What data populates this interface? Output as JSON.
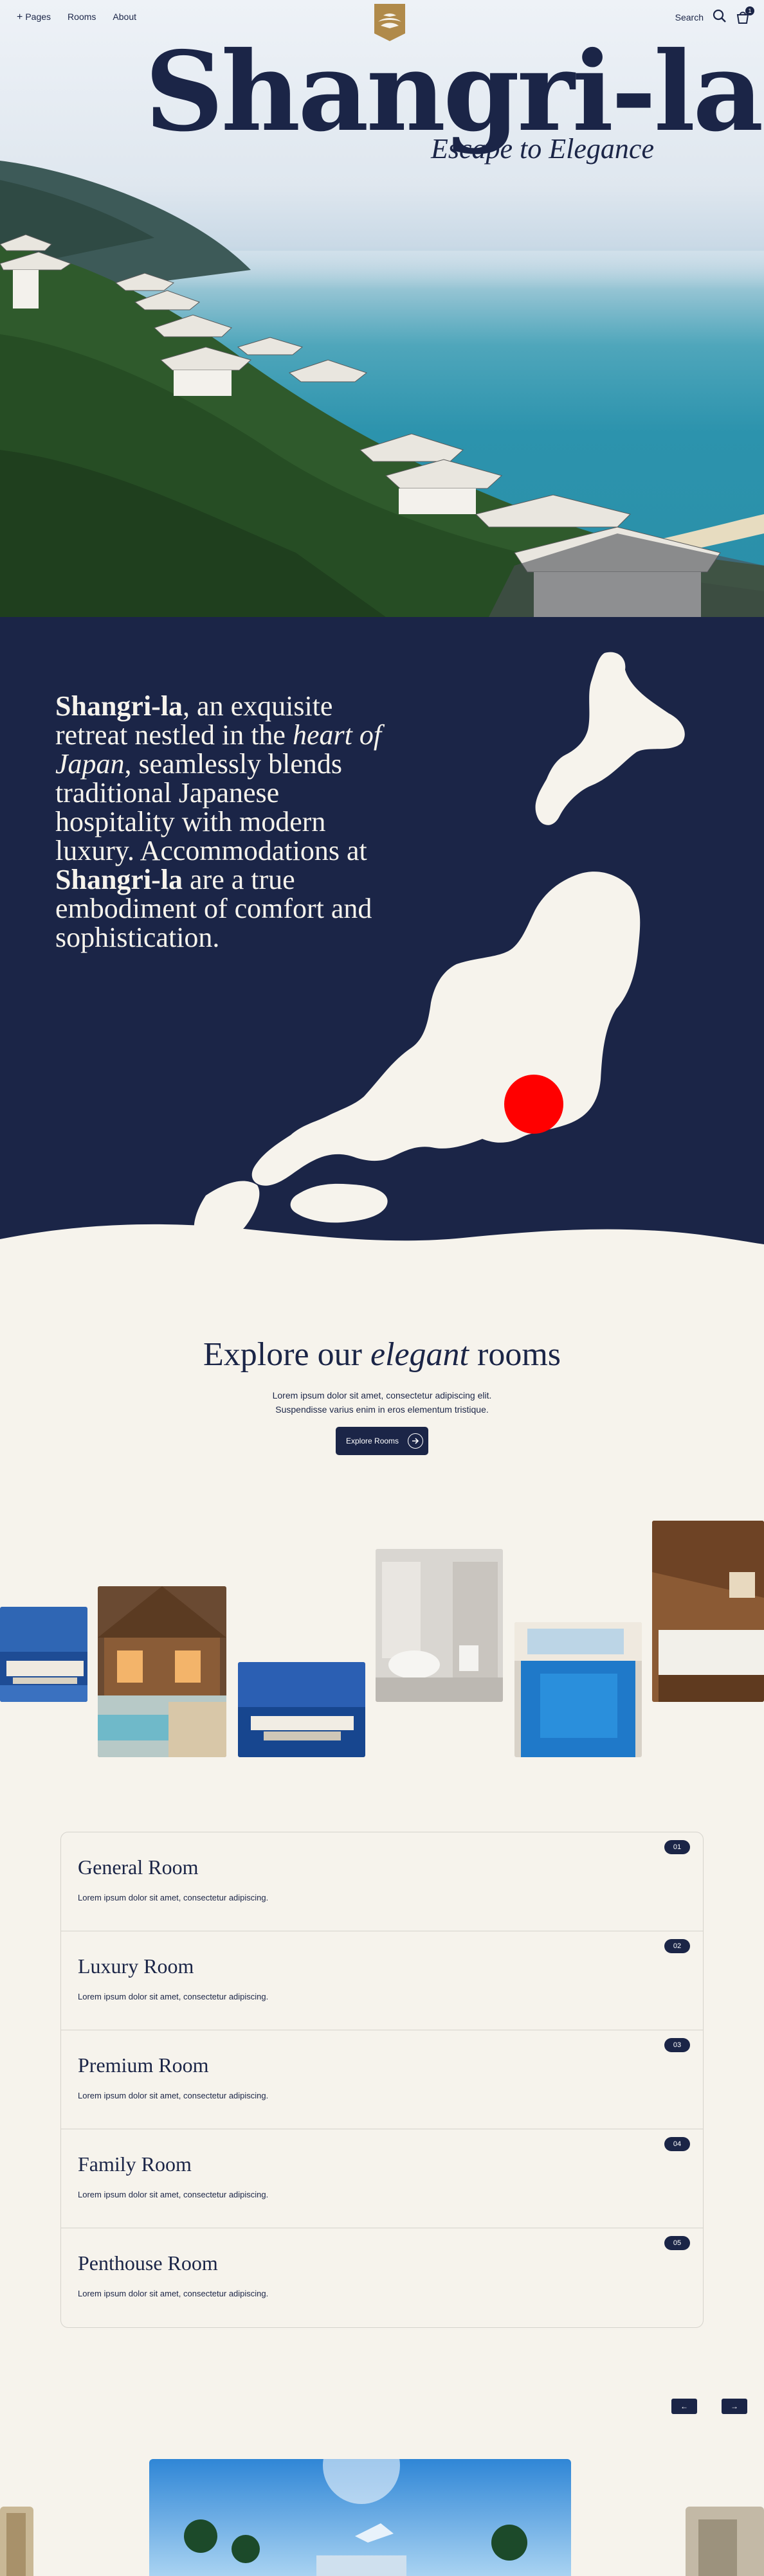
{
  "nav": {
    "pages_label": "Pages",
    "rooms_label": "Rooms",
    "about_label": "About",
    "search_label": "Search",
    "cart_count": "1"
  },
  "hero": {
    "brand": "Shangri-la",
    "tagline": "Escape to Elegance"
  },
  "intro": {
    "brand_1": "Shangri-la",
    "text_1": ", an exquisite retreat nestled in the ",
    "emph": "heart of Japan",
    "text_2": ", seamlessly blends traditional Japanese hospitality with modern luxury. Accommodations at ",
    "brand_2": "Shangri-la",
    "text_3": " are a true embodiment of comfort and sophistication."
  },
  "explore": {
    "title_pre": "Explore our ",
    "title_emph": "elegant",
    "title_post": " rooms",
    "sub_line_1": "Lorem ipsum dolor sit amet, consectetur adipiscing elit.",
    "sub_line_2": "Suspendisse varius enim in eros elementum tristique.",
    "button_label": "Explore Rooms"
  },
  "rooms": [
    {
      "name": "General Room",
      "desc": "Lorem ipsum dolor sit amet, consectetur adipiscing.",
      "num": "01"
    },
    {
      "name": "Luxury Room",
      "desc": "Lorem ipsum dolor sit amet, consectetur adipiscing.",
      "num": "02"
    },
    {
      "name": "Premium Room",
      "desc": "Lorem ipsum dolor sit amet, consectetur adipiscing.",
      "num": "03"
    },
    {
      "name": "Family Room",
      "desc": "Lorem ipsum dolor sit amet, consectetur adipiscing.",
      "num": "04"
    },
    {
      "name": "Penthouse Room",
      "desc": "Lorem ipsum dolor sit amet, consectetur adipiscing.",
      "num": "05"
    }
  ],
  "slider": {
    "prev_label": "←",
    "next_label": "→"
  },
  "colors": {
    "navy": "#1b2547",
    "cream": "#f6f3ec",
    "gold": "#b08a4a",
    "marker": "#ff0000"
  }
}
